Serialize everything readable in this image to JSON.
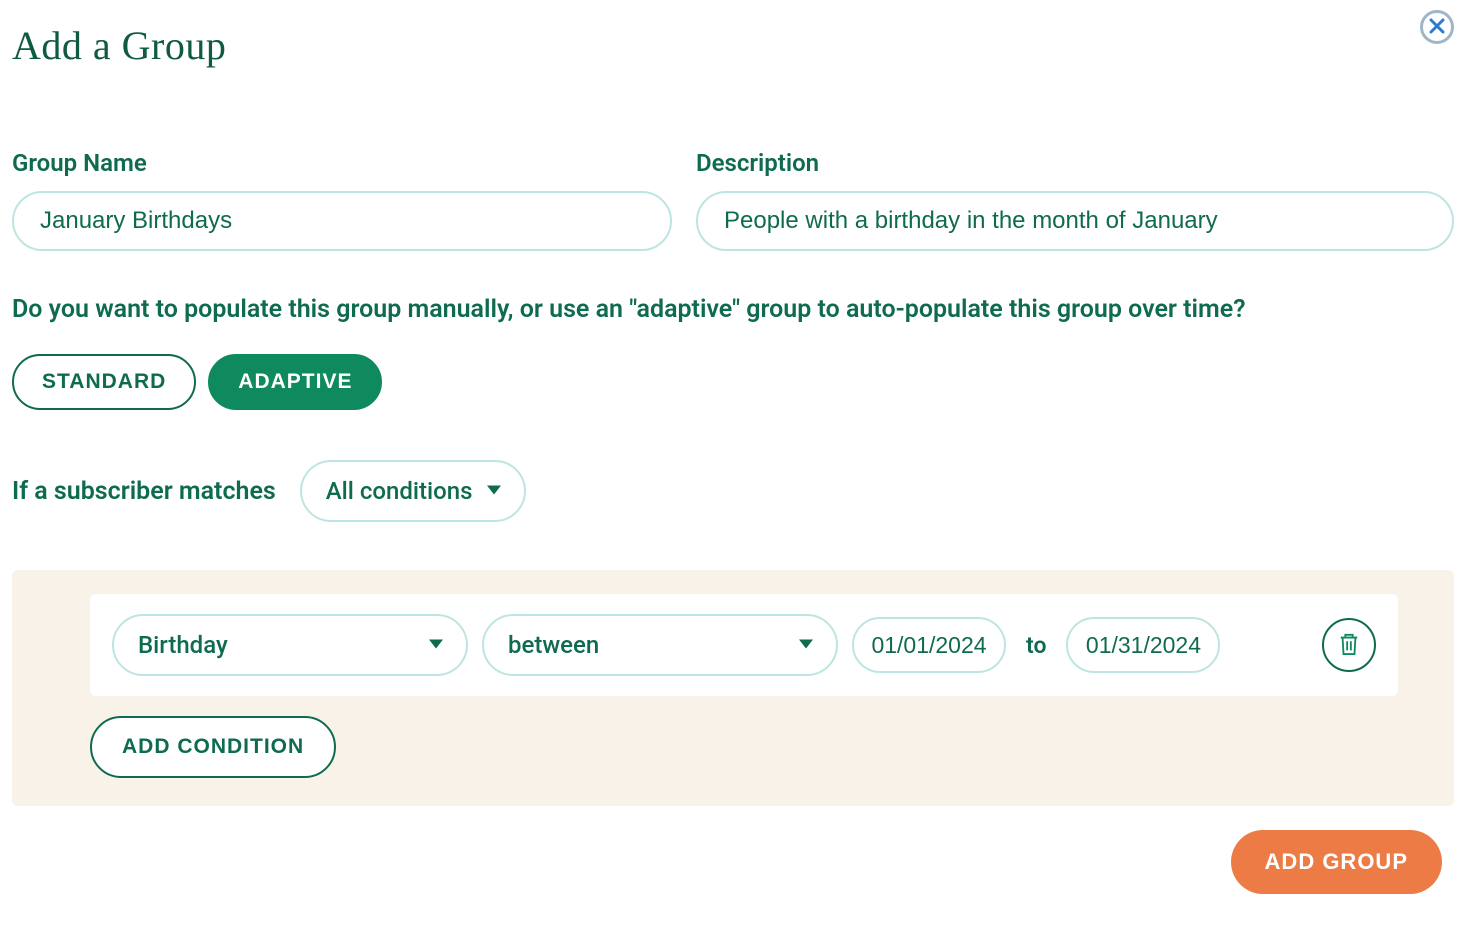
{
  "dialog": {
    "title": "Add a Group"
  },
  "fields": {
    "group_name": {
      "label": "Group Name",
      "value": "January Birthdays"
    },
    "description": {
      "label": "Description",
      "value": "People with a birthday in the month of January"
    }
  },
  "question": "Do you want to populate this group manually, or use an \"adaptive\" group to auto-populate this group over time?",
  "type_toggle": {
    "standard": "STANDARD",
    "adaptive": "ADAPTIVE",
    "selected": "adaptive"
  },
  "match": {
    "prefix": "If a subscriber matches",
    "selected": "All conditions"
  },
  "condition": {
    "field": "Birthday",
    "operator": "between",
    "date_from": "01/01/2024",
    "to_label": "to",
    "date_to": "01/31/2024"
  },
  "buttons": {
    "add_condition": "ADD CONDITION",
    "submit": "ADD GROUP"
  },
  "colors": {
    "primary_green": "#0f6b4f",
    "active_green": "#0f8a5f",
    "pale_border": "#bde5e1",
    "panel_bg": "#f8f2e8",
    "accent_orange": "#ec7b46",
    "close_ring": "#9fb6c7",
    "close_x": "#2d7bd1"
  }
}
